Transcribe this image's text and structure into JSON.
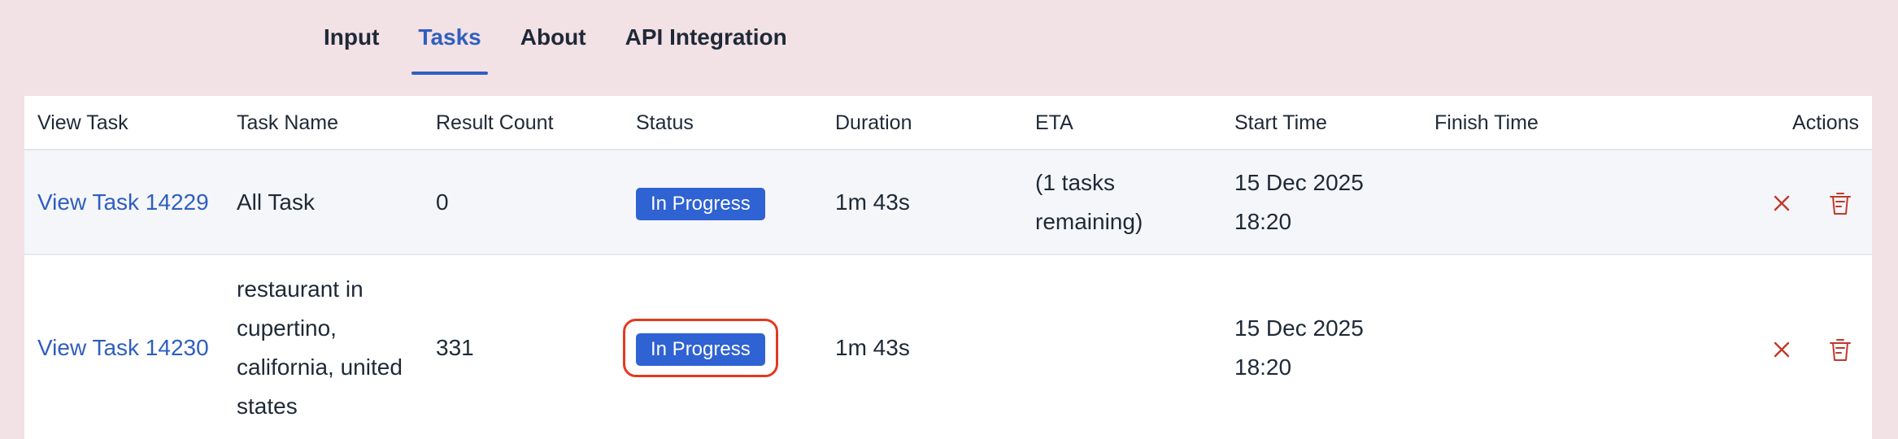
{
  "tabs": [
    {
      "label": "Input",
      "active": false
    },
    {
      "label": "Tasks",
      "active": true
    },
    {
      "label": "About",
      "active": false
    },
    {
      "label": "API Integration",
      "active": false
    }
  ],
  "colors": {
    "background": "#f2e1e5",
    "accent": "#2f5fbf",
    "badge": "#2f62d2",
    "danger": "#c0392b",
    "highlight": "#e23a1f"
  },
  "table": {
    "headers": {
      "view_task": "View Task",
      "task_name": "Task Name",
      "result_count": "Result Count",
      "status": "Status",
      "duration": "Duration",
      "eta": "ETA",
      "start_time": "Start Time",
      "finish_time": "Finish Time",
      "actions": "Actions"
    },
    "rows": [
      {
        "view_task": "View Task 14229",
        "task_name": "All Task",
        "result_count": "0",
        "status": "In Progress",
        "duration": "1m 43s",
        "eta": "(1 tasks remaining)",
        "start_time": "15 Dec 2025 18:20",
        "finish_time": "",
        "actions": [
          "close-icon",
          "trash-icon"
        ]
      },
      {
        "view_task": "View Task 14230",
        "task_name": "restaurant in cupertino, california, united states",
        "result_count": "331",
        "status": "In Progress",
        "duration": "1m 43s",
        "eta": "",
        "start_time": "15 Dec 2025 18:20",
        "finish_time": "",
        "actions": [
          "close-icon",
          "trash-icon"
        ]
      }
    ]
  }
}
